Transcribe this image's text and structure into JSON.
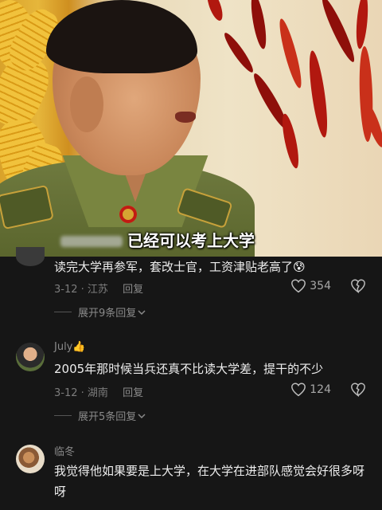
{
  "video": {
    "subtitle": "已经可以考上大学"
  },
  "comments": [
    {
      "username": "",
      "text": "读完大学再参军，套改士官，工资津贴老高了",
      "emoji": "😰",
      "date": "3-12",
      "location": "江苏",
      "reply_label": "回复",
      "likes": "354",
      "expand_label": "展开9条回复"
    },
    {
      "username": "July",
      "username_emoji": "👍",
      "text": "2005年那时候当兵还真不比读大学差，提干的不少",
      "date": "3-12",
      "location": "湖南",
      "reply_label": "回复",
      "likes": "124",
      "expand_label": "展开5条回复"
    },
    {
      "username": "临冬",
      "text": "我觉得他如果要是上大学，在大学在进部队感觉会好很多呀呀"
    }
  ],
  "colors": {
    "background": "#161616",
    "text": "#ededed",
    "muted": "#7d7d7d"
  },
  "icons": [
    "heart-icon",
    "broken-heart-icon",
    "chevron-down-icon"
  ]
}
